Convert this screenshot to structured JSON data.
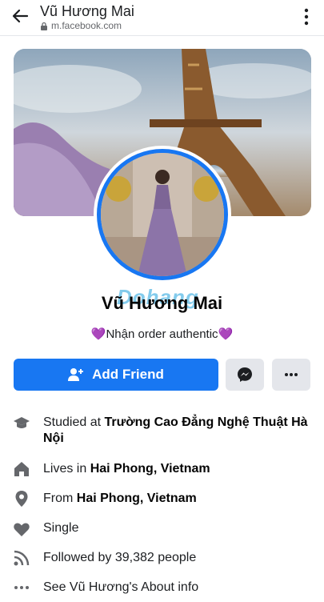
{
  "header": {
    "title": "Vũ Hương Mai",
    "url": "m.facebook.com"
  },
  "profile": {
    "name": "Vũ Hương Mai",
    "watermark": "Dohang",
    "bio_heart_left": "💜",
    "bio_text": "Nhận order authentic",
    "bio_heart_right": "💜"
  },
  "actions": {
    "add_friend_label": "Add Friend"
  },
  "details": {
    "studied_prefix": "Studied at ",
    "studied_school": "Trường Cao Đẳng Nghệ Thuật Hà Nội",
    "lives_prefix": "Lives in ",
    "lives_place": "Hai Phong, Vietnam",
    "from_prefix": "From ",
    "from_place": "Hai Phong, Vietnam",
    "relationship": "Single",
    "followed_by": "Followed by 39,382 people",
    "see_about": "See Vũ Hương's About info"
  },
  "colors": {
    "primary": "#1877f2",
    "secondary_button": "#e4e6eb",
    "icon_gray": "#65676b"
  }
}
